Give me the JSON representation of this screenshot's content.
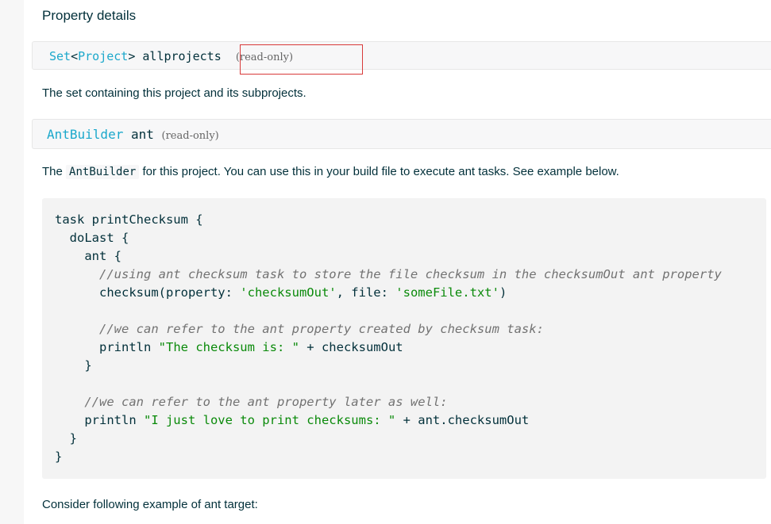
{
  "section_title": "Property details",
  "properties": [
    {
      "type": "Set",
      "open": "<",
      "type_param": "Project",
      "close": ">",
      "name": "allprojects",
      "modifier": "(read-only)",
      "description": "The set containing this project and its subprojects."
    },
    {
      "type": "AntBuilder",
      "name": "ant",
      "modifier": "(read-only)",
      "description_prefix": "The",
      "description_code": "AntBuilder",
      "description_suffix": "for this project. You can use this in your build file to execute ant tasks. See example below."
    }
  ],
  "code_lines": [
    [
      {
        "t": "task printChecksum {",
        "k": "plain"
      }
    ],
    [
      {
        "t": "  doLast {",
        "k": "plain"
      }
    ],
    [
      {
        "t": "    ant {",
        "k": "plain"
      }
    ],
    [
      {
        "t": "      //using ant checksum task to store the file checksum in the checksumOut ant property",
        "k": "comment"
      }
    ],
    [
      {
        "t": "      checksum(property: ",
        "k": "plain"
      },
      {
        "t": "'checksumOut'",
        "k": "string"
      },
      {
        "t": ", file: ",
        "k": "plain"
      },
      {
        "t": "'someFile.txt'",
        "k": "string"
      },
      {
        "t": ")",
        "k": "plain"
      }
    ],
    [
      {
        "t": "",
        "k": "plain"
      }
    ],
    [
      {
        "t": "      //we can refer to the ant property created by checksum task:",
        "k": "comment"
      }
    ],
    [
      {
        "t": "      println ",
        "k": "plain"
      },
      {
        "t": "\"The checksum is: \"",
        "k": "string"
      },
      {
        "t": " + checksumOut",
        "k": "plain"
      }
    ],
    [
      {
        "t": "    }",
        "k": "plain"
      }
    ],
    [
      {
        "t": "",
        "k": "plain"
      }
    ],
    [
      {
        "t": "    //we can refer to the ant property later as well:",
        "k": "comment"
      }
    ],
    [
      {
        "t": "    println ",
        "k": "plain"
      },
      {
        "t": "\"I just love to print checksums: \"",
        "k": "string"
      },
      {
        "t": " + ant.checksumOut",
        "k": "plain"
      }
    ],
    [
      {
        "t": "  }",
        "k": "plain"
      }
    ],
    [
      {
        "t": "}",
        "k": "plain"
      }
    ]
  ],
  "footer_text": "Consider following example of ant target:",
  "colors": {
    "type_link": "#1ba8cb",
    "string": "#0a8a0a",
    "comment": "#727272",
    "highlight_box": "#d83a3a"
  }
}
